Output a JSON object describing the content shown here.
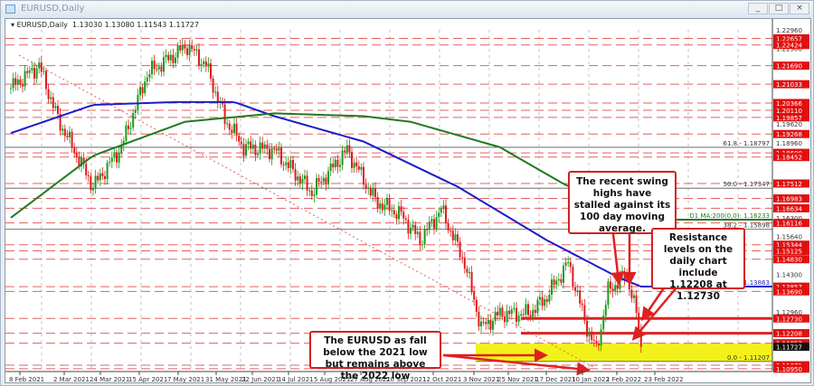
{
  "window": {
    "title": "EURUSD,Daily",
    "buttons": [
      "_",
      "□",
      "×"
    ]
  },
  "header": {
    "symbol": "EURUSD,Daily",
    "ohlc": "1.13030 1.13080 1.11543 1.11727"
  },
  "chart_data": {
    "type": "candlestick",
    "title": "EURUSD,Daily",
    "ylim": [
      1.108,
      1.231
    ],
    "x_ticks": [
      "8 Feb 2021",
      "2 Mar 2021",
      "24 Mar 2021",
      "15 Apr 2021",
      "7 May 2021",
      "31 May 2021",
      "22 Jun 2021",
      "14 Jul 2021",
      "5 Aug 2021",
      "27 Aug 2021",
      "20 Sep 2021",
      "12 Oct 2021",
      "3 Nov 2021",
      "25 Nov 2021",
      "17 Dec 2021",
      "10 Jan 2022",
      "1 Feb 2022",
      "23 Feb 2022"
    ],
    "y_ticks": [
      "1.22960",
      "1.22300",
      "1.19620",
      "1.18960",
      "1.16300",
      "1.15640",
      "1.14300",
      "1.12960"
    ],
    "close_anchors": [
      [
        0,
        1.209
      ],
      [
        12,
        1.217
      ],
      [
        20,
        1.198
      ],
      [
        35,
        1.174
      ],
      [
        47,
        1.188
      ],
      [
        58,
        1.214
      ],
      [
        75,
        1.224
      ],
      [
        83,
        1.217
      ],
      [
        91,
        1.198
      ],
      [
        99,
        1.188
      ],
      [
        112,
        1.187
      ],
      [
        128,
        1.172
      ],
      [
        143,
        1.187
      ],
      [
        155,
        1.169
      ],
      [
        166,
        1.164
      ],
      [
        174,
        1.155
      ],
      [
        183,
        1.166
      ],
      [
        193,
        1.147
      ],
      [
        200,
        1.124
      ],
      [
        208,
        1.129
      ],
      [
        220,
        1.129
      ],
      [
        227,
        1.134
      ],
      [
        237,
        1.147
      ],
      [
        245,
        1.124
      ],
      [
        249,
        1.116
      ],
      [
        254,
        1.137
      ],
      [
        262,
        1.143
      ],
      [
        266,
        1.129
      ],
      [
        268,
        1.11727
      ]
    ],
    "ma100": [
      [
        0,
        1.193
      ],
      [
        35,
        1.203
      ],
      [
        70,
        1.204
      ],
      [
        95,
        1.204
      ],
      [
        112,
        1.199
      ],
      [
        150,
        1.19
      ],
      [
        190,
        1.174
      ],
      [
        228,
        1.155
      ],
      [
        258,
        1.142
      ],
      [
        268,
        1.1386
      ]
    ],
    "ma200": [
      [
        0,
        1.163
      ],
      [
        35,
        1.185
      ],
      [
        74,
        1.197
      ],
      [
        112,
        1.2
      ],
      [
        150,
        1.199
      ],
      [
        170,
        1.197
      ],
      [
        208,
        1.188
      ],
      [
        235,
        1.175
      ],
      [
        262,
        1.165
      ],
      [
        268,
        1.1623
      ]
    ],
    "level_labels": [
      "1.22657",
      "1.22424",
      "1.21690",
      "1.21033",
      "1.20366",
      "1.20110",
      "1.19857",
      "1.19268",
      "1.18600",
      "1.18452",
      "1.17512",
      "1.16983",
      "1.16634",
      "1.16116",
      "1.15344",
      "1.15125",
      "1.14830",
      "1.13857",
      "1.13690",
      "1.12730",
      "1.12208",
      "1.11853",
      "1.11071",
      "1.10950"
    ],
    "current_price": "1.11727",
    "fib": [
      {
        "label": "61.8 - 1.18797",
        "price": 1.18797
      },
      {
        "label": "50.0 - 1.17347",
        "price": 1.17347
      },
      {
        "label": "38.2 - 1.15898",
        "price": 1.15898
      },
      {
        "label": "0.0 - 1.11207",
        "price": 1.11207
      }
    ],
    "ma_labels": {
      "ma200": "D1 MA:200(0,0): 1.16233",
      "ma100": "D1 MA:100(0,0): 1.13863"
    },
    "support_zone": [
      1.11207,
      1.11853
    ],
    "resistance_lines": [
      1.1273,
      1.12208
    ],
    "annotations": {
      "swing": "The recent swing highs have stalled against its 100 day moving average.",
      "resistance": "Resistance levels on the daily chart include 1.12208 at 1.12730",
      "low": "The EURUSD as fall below the 2021 low but remains above the 2022 low"
    },
    "colors": {
      "up": "#1a9a1a",
      "down": "#e01b1b",
      "ma100": "#1c1cc8",
      "ma200": "#1f7a1f",
      "level": "#e36060",
      "zone": "#f2f21a"
    }
  }
}
